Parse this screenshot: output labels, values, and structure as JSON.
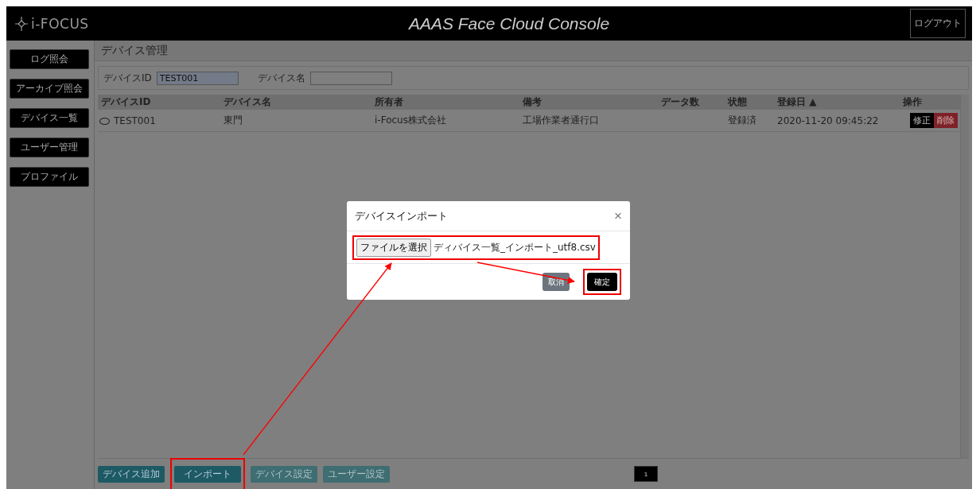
{
  "header": {
    "logo": "i-FOCUS",
    "title": "AAAS Face Cloud Console",
    "logout": "ログアウト"
  },
  "sidebar": {
    "items": [
      {
        "label": "ログ照会"
      },
      {
        "label": "アーカイブ照会"
      },
      {
        "label": "デバイス一覧"
      },
      {
        "label": "ユーザー管理"
      },
      {
        "label": "プロファイル"
      }
    ]
  },
  "page_title": "デバイス管理",
  "filters": [
    {
      "label": "デバイスID",
      "value": "TEST001"
    },
    {
      "label": "デバイス名"
    }
  ],
  "table": {
    "columns": [
      "デバイスID",
      "デバイス名",
      "所有者",
      "備考",
      "データ数",
      "状態",
      "登録日 ▲",
      "操作"
    ],
    "rows": [
      {
        "selected": false,
        "cells": [
          "TEST001",
          "東門",
          "i-Focus株式会社",
          "工場作業者通行口",
          "",
          "登録済",
          "2020-11-20 09:45:22"
        ],
        "actions": [
          {
            "label": "修正",
            "kind": "edit"
          },
          {
            "label": "削除",
            "kind": "delete"
          }
        ]
      }
    ]
  },
  "footer_buttons": [
    {
      "label": "デバイス追加",
      "disabled": false
    },
    {
      "label": "インポート",
      "disabled": false
    },
    {
      "label": "デバイス設定",
      "disabled": true
    },
    {
      "label": "ユーザー設定",
      "disabled": true
    }
  ],
  "pagination": [
    {
      "label": "1",
      "selected": true
    }
  ],
  "dialog": {
    "title": "デバイスインポート",
    "close": "×",
    "file_button": "ファイルを選択",
    "file_name": "ディバイス一覧_インポート_utf8.csv",
    "buttons": [
      {
        "label": "取消",
        "kind": "secondary"
      },
      {
        "label": "確定",
        "kind": "primary"
      }
    ]
  }
}
